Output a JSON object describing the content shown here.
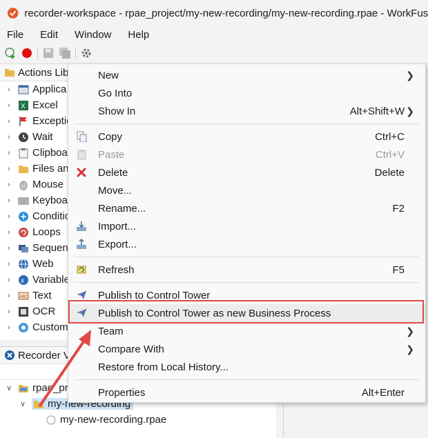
{
  "window": {
    "title": "recorder-workspace - rpae_project/my-new-recording/my-new-recording.rpae - WorkFusion"
  },
  "menubar": [
    "File",
    "Edit",
    "Window",
    "Help"
  ],
  "toolbar": {
    "icons": [
      "new-icon",
      "record-icon",
      "save-icon",
      "save-all-icon",
      "settings-icon"
    ]
  },
  "actions_library": {
    "title": "Actions Libr",
    "items": [
      {
        "label": "Applica",
        "icon": "application-icon",
        "color": "#3a6ea5"
      },
      {
        "label": "Excel",
        "icon": "excel-icon",
        "color": "#1e7145"
      },
      {
        "label": "Exceptio",
        "icon": "flag-icon",
        "color": "#d93030"
      },
      {
        "label": "Wait",
        "icon": "clock-icon",
        "color": "#444444"
      },
      {
        "label": "Clipboa",
        "icon": "clipboard-icon",
        "color": "#777777"
      },
      {
        "label": "Files an",
        "icon": "folder-icon",
        "color": "#e8b84a"
      },
      {
        "label": "Mouse",
        "icon": "mouse-icon",
        "color": "#888888"
      },
      {
        "label": "Keyboa",
        "icon": "keyboard-icon",
        "color": "#666666"
      },
      {
        "label": "Conditio",
        "icon": "condition-icon",
        "color": "#2c8fd6"
      },
      {
        "label": "Loops",
        "icon": "loop-icon",
        "color": "#d04a4a"
      },
      {
        "label": "Sequen",
        "icon": "sequence-icon",
        "color": "#3b5b8a"
      },
      {
        "label": "Web",
        "icon": "globe-icon",
        "color": "#2b6cb0"
      },
      {
        "label": "Variable",
        "icon": "variable-icon",
        "color": "#2b6cb0"
      },
      {
        "label": "Text",
        "icon": "text-icon",
        "color": "#a65b2b"
      },
      {
        "label": "OCR",
        "icon": "ocr-icon",
        "color": "#555555"
      },
      {
        "label": "Custom",
        "icon": "custom-icon",
        "color": "#4a9bd8"
      }
    ]
  },
  "recorder_view": {
    "title": "Recorder V",
    "tree": [
      {
        "label": "rpae_pr",
        "level": 0,
        "icon": "project-folder-icon"
      },
      {
        "label": "my-new-recording",
        "level": 1,
        "icon": "open-folder-icon"
      },
      {
        "label": "my-new-recording.rpae",
        "level": 2,
        "icon": "file-icon"
      }
    ]
  },
  "context_menu": {
    "items": [
      {
        "label": "New",
        "shortcut": "",
        "submenu": true,
        "icon": ""
      },
      {
        "label": "Go Into",
        "shortcut": "",
        "submenu": false,
        "icon": ""
      },
      {
        "label": "Show In",
        "shortcut": "Alt+Shift+W",
        "submenu": true,
        "icon": ""
      },
      {
        "separator": true
      },
      {
        "label": "Copy",
        "shortcut": "Ctrl+C",
        "submenu": false,
        "icon": "copy-icon"
      },
      {
        "label": "Paste",
        "shortcut": "Ctrl+V",
        "submenu": false,
        "icon": "paste-icon",
        "disabled": true
      },
      {
        "label": "Delete",
        "shortcut": "Delete",
        "submenu": false,
        "icon": "delete-icon"
      },
      {
        "label": "Move...",
        "shortcut": "",
        "submenu": false,
        "icon": ""
      },
      {
        "label": "Rename...",
        "shortcut": "F2",
        "submenu": false,
        "icon": ""
      },
      {
        "label": "Import...",
        "shortcut": "",
        "submenu": false,
        "icon": "import-icon"
      },
      {
        "label": "Export...",
        "shortcut": "",
        "submenu": false,
        "icon": "export-icon"
      },
      {
        "separator": true
      },
      {
        "label": "Refresh",
        "shortcut": "F5",
        "submenu": false,
        "icon": "refresh-icon"
      },
      {
        "separator": true
      },
      {
        "label": "Publish to Control Tower",
        "shortcut": "",
        "submenu": false,
        "icon": "send-icon"
      },
      {
        "label": "Publish to Control Tower as new Business Process",
        "shortcut": "",
        "submenu": false,
        "icon": "send-icon",
        "highlighted": true
      },
      {
        "label": "Team",
        "shortcut": "",
        "submenu": true,
        "icon": ""
      },
      {
        "label": "Compare With",
        "shortcut": "",
        "submenu": true,
        "icon": ""
      },
      {
        "label": "Restore from Local History...",
        "shortcut": "",
        "submenu": false,
        "icon": ""
      },
      {
        "separator": true
      },
      {
        "label": "Properties",
        "shortcut": "Alt+Enter",
        "submenu": false,
        "icon": ""
      }
    ]
  },
  "colors": {
    "highlight_border": "#e04848",
    "arrow": "#e04848"
  }
}
